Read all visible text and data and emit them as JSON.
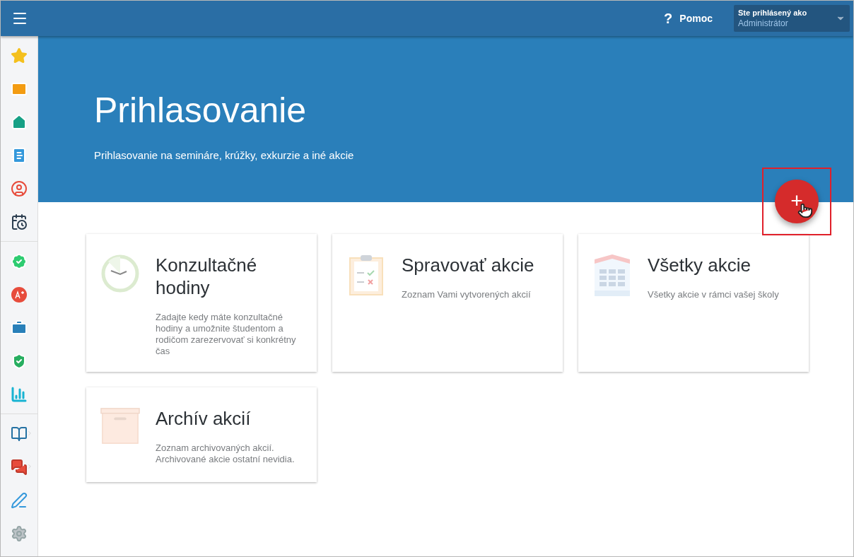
{
  "header": {
    "help_icon": "?",
    "help_label": "Pomoc",
    "user": {
      "caption": "Ste prihlásený ako",
      "name": "Administrátor"
    }
  },
  "sidebar": {
    "groups": [
      {
        "items": [
          {
            "kind": "star",
            "submenu": false
          },
          {
            "kind": "mail",
            "submenu": false
          },
          {
            "kind": "home",
            "submenu": false
          },
          {
            "kind": "notebook",
            "submenu": false
          },
          {
            "kind": "user",
            "submenu": false
          },
          {
            "kind": "calendar",
            "submenu": false
          }
        ]
      },
      {
        "items": [
          {
            "kind": "badge",
            "submenu": false
          },
          {
            "kind": "grade",
            "submenu": false
          },
          {
            "kind": "briefcase",
            "submenu": false
          },
          {
            "kind": "shield",
            "submenu": false
          },
          {
            "kind": "chart",
            "submenu": false
          }
        ]
      },
      {
        "items": [
          {
            "kind": "book",
            "submenu": true
          },
          {
            "kind": "chat",
            "submenu": true
          },
          {
            "kind": "pencil",
            "submenu": false
          },
          {
            "kind": "gear",
            "submenu": false
          }
        ]
      }
    ]
  },
  "banner": {
    "title": "Prihlasovanie",
    "subtitle": "Prihlasovanie na semináre, krúžky, exkurzie a iné akcie"
  },
  "add_button": {
    "label": "+",
    "highlighted": true
  },
  "cards": [
    {
      "kind": "clock",
      "title": "Konzultačné hodiny",
      "description": "Zadajte kedy máte konzultačné hodiny a umožnite študentom a rodičom zarezervovať si konkrétny čas"
    },
    {
      "kind": "clipboard",
      "title": "Spravovať akcie",
      "description": "Zoznam Vami vytvorených akcií"
    },
    {
      "kind": "building",
      "title": "Všetky akcie",
      "description": "Všetky akcie v rámci vašej školy"
    },
    {
      "kind": "archive",
      "title": "Archív akcií",
      "description": "Zoznam archivovaných akcií. Archivované akcie ostatní nevidia."
    }
  ]
}
